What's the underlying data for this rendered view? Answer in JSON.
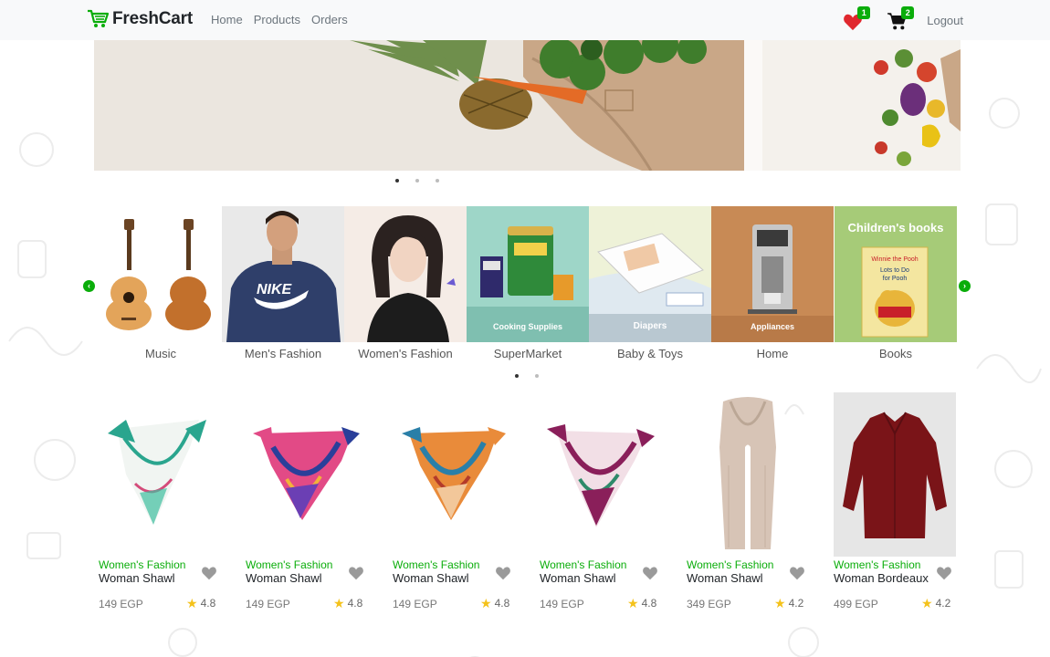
{
  "brand": {
    "name": "FreshCart",
    "logo_icon": "cart-logo-icon",
    "accent": "#0aad0a"
  },
  "nav": {
    "links": [
      "Home",
      "Products",
      "Orders"
    ],
    "wishlist_count": "1",
    "cart_count": "2",
    "logout_label": "Logout"
  },
  "hero": {
    "slides": 3,
    "active_slide": 1
  },
  "categories": {
    "items": [
      {
        "label": "Music"
      },
      {
        "label": "Men's Fashion"
      },
      {
        "label": "Women's Fashion"
      },
      {
        "label": "SuperMarket",
        "overlay": "Cooking Supplies"
      },
      {
        "label": "Baby & Toys",
        "overlay": "Diapers"
      },
      {
        "label": "Home",
        "overlay": "Appliances"
      },
      {
        "label": "Books",
        "overlay": "Children's books",
        "book_text": "Winnie the Pooh Lots to Do for Pooh"
      }
    ],
    "prev_icon": "chevron-left-icon",
    "next_icon": "chevron-right-icon",
    "pages": 2,
    "active_page": 1
  },
  "products": [
    {
      "category": "Women's Fashion",
      "title": "Woman Shawl",
      "price": "149 EGP",
      "rating": "4.8"
    },
    {
      "category": "Women's Fashion",
      "title": "Woman Shawl",
      "price": "149 EGP",
      "rating": "4.8"
    },
    {
      "category": "Women's Fashion",
      "title": "Woman Shawl",
      "price": "149 EGP",
      "rating": "4.8"
    },
    {
      "category": "Women's Fashion",
      "title": "Woman Shawl",
      "price": "149 EGP",
      "rating": "4.8"
    },
    {
      "category": "Women's Fashion",
      "title": "Woman Shawl",
      "price": "349 EGP",
      "rating": "4.2"
    },
    {
      "category": "Women's Fashion",
      "title": "Woman Bordeaux",
      "price": "499 EGP",
      "rating": "4.2"
    }
  ]
}
